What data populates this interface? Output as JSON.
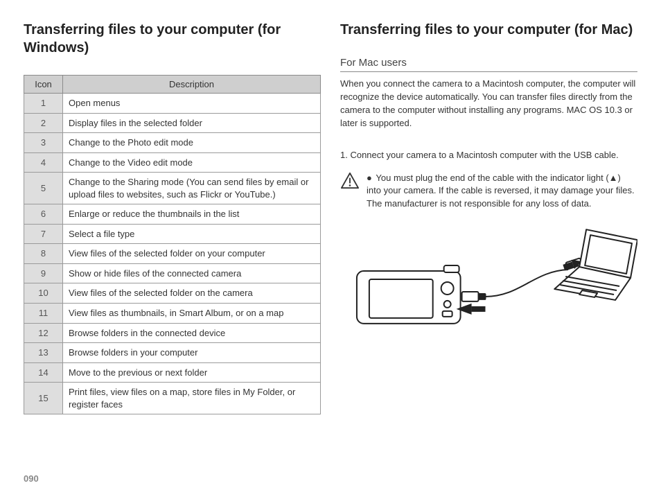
{
  "pageNumber": "090",
  "left": {
    "heading": "Transferring files to your computer (for Windows)",
    "tableHeaders": {
      "icon": "Icon",
      "desc": "Description"
    },
    "rows": [
      {
        "n": "1",
        "d": "Open menus"
      },
      {
        "n": "2",
        "d": "Display files in the selected folder"
      },
      {
        "n": "3",
        "d": "Change to the Photo edit mode"
      },
      {
        "n": "4",
        "d": "Change to the Video edit mode"
      },
      {
        "n": "5",
        "d": "Change to the Sharing mode (You can send files by email or upload files to websites, such as Flickr or YouTube.)"
      },
      {
        "n": "6",
        "d": "Enlarge or reduce the thumbnails in the list"
      },
      {
        "n": "7",
        "d": "Select a file type"
      },
      {
        "n": "8",
        "d": "View files of the selected folder on your computer"
      },
      {
        "n": "9",
        "d": "Show or hide files of the connected camera"
      },
      {
        "n": "10",
        "d": "View files of the selected folder on the camera"
      },
      {
        "n": "11",
        "d": "View files as thumbnails, in Smart Album, or on a map"
      },
      {
        "n": "12",
        "d": "Browse folders in the connected device"
      },
      {
        "n": "13",
        "d": "Browse folders in your computer"
      },
      {
        "n": "14",
        "d": "Move to the previous or next folder"
      },
      {
        "n": "15",
        "d": "Print files, view files on a map, store files in My Folder, or register faces"
      }
    ]
  },
  "right": {
    "heading": "Transferring files to your computer (for Mac)",
    "subhead": "For Mac users",
    "intro": "When you connect the camera to a Macintosh computer, the computer will recognize the device automatically. You can transfer files directly from the camera to the computer without installing any programs. MAC OS 10.3 or later is supported.",
    "step1": "1. Connect your camera to a Macintosh computer with the USB cable.",
    "note": "You must plug the end of the cable with the indicator light (▲) into your camera. If the cable is reversed, it may damage your files. The manufacturer is not responsible for any loss of data."
  }
}
